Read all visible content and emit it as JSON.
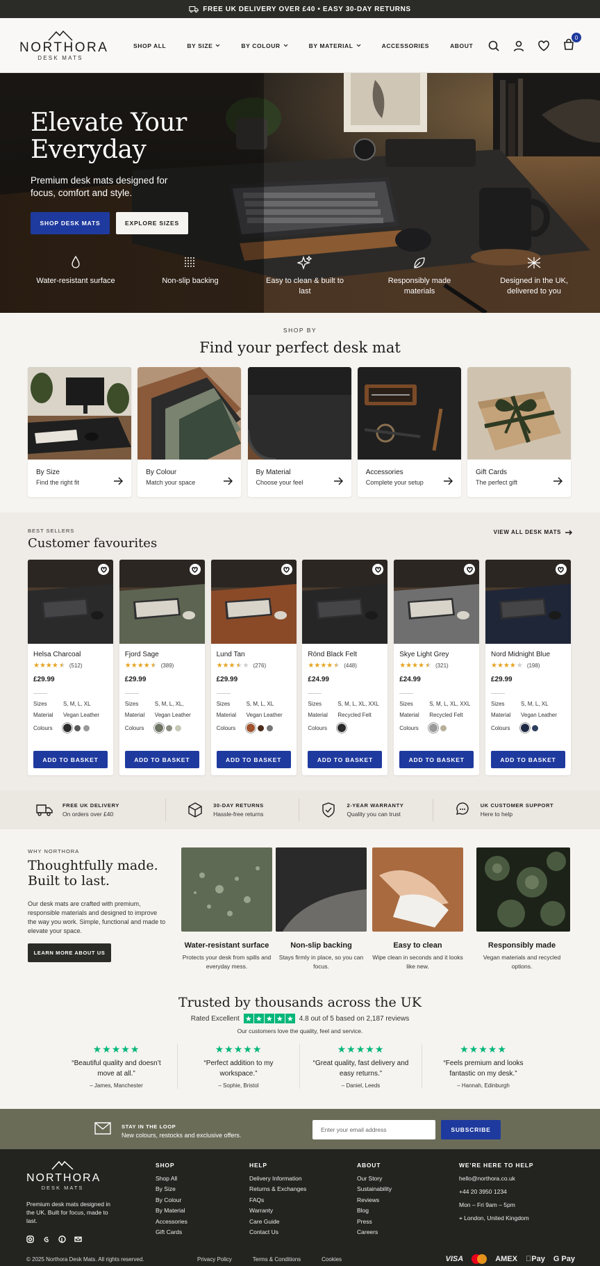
{
  "announcement": {
    "text": "FREE UK DELIVERY OVER £40  •  EASY 30-DAY RETURNS"
  },
  "header": {
    "brand": "NORTHORA",
    "sub": "DESK MATS",
    "nav": [
      "SHOP ALL",
      "BY SIZE",
      "BY COLOUR",
      "BY MATERIAL",
      "ACCESSORIES",
      "ABOUT"
    ],
    "cart_count": "0"
  },
  "hero": {
    "title_line1": "Elevate Your",
    "title_line2": "Everyday",
    "subtitle": "Premium desk mats designed for focus, comfort and style.",
    "btn_primary": "SHOP DESK MATS",
    "btn_secondary": "EXPLORE SIZES",
    "features": [
      {
        "icon": "droplet-icon",
        "label": "Water-resistant surface"
      },
      {
        "icon": "grid-dots-icon",
        "label": "Non-slip backing"
      },
      {
        "icon": "sparkle-icon",
        "label": "Easy to clean & built to last"
      },
      {
        "icon": "leaf-icon",
        "label": "Responsibly made materials"
      },
      {
        "icon": "union-flag-icon",
        "label": "Designed in the UK, delivered to you"
      }
    ]
  },
  "shop_by": {
    "eyebrow": "SHOP BY",
    "title": "Find your perfect desk mat",
    "cards": [
      {
        "title": "By Size",
        "sub": "Find the right fit"
      },
      {
        "title": "By Colour",
        "sub": "Match your space"
      },
      {
        "title": "By Material",
        "sub": "Choose your feel"
      },
      {
        "title": "Accessories",
        "sub": "Complete your setup"
      },
      {
        "title": "Gift Cards",
        "sub": "The perfect gift"
      }
    ]
  },
  "best_sellers": {
    "eyebrow": "BEST SELLERS",
    "title": "Customer favourites",
    "view_all": "VIEW ALL DESK MATS",
    "labels": {
      "sizes": "Sizes",
      "material": "Material",
      "colours": "Colours"
    },
    "add_label": "ADD TO BASKET",
    "products": [
      {
        "name": "Helsa Charcoal",
        "rating": 4.5,
        "reviews": "(512)",
        "price": "£29.99",
        "sizes": "S, M, L, XL",
        "material": "Vegan Leather",
        "colours": [
          "#2b2b2b",
          "#5a5a5a",
          "#9a9a9a"
        ],
        "bg": "#2a2a2a"
      },
      {
        "name": "Fjord Sage",
        "rating": 4.5,
        "reviews": "(389)",
        "price": "£29.99",
        "sizes": "S, M, L, XL,",
        "material": "Vegan Leather",
        "colours": [
          "#6e7463",
          "#8c8e80",
          "#c8c8b8"
        ],
        "bg": "#5d6452"
      },
      {
        "name": "Lund Tan",
        "rating": 3.5,
        "reviews": "(276)",
        "price": "£29.99",
        "sizes": "S, M, L, XL",
        "material": "Vegan Leather",
        "colours": [
          "#a0522d",
          "#4a2a1a",
          "#777"
        ],
        "bg": "#8a4a28"
      },
      {
        "name": "Rönd Black Felt",
        "rating": 4.5,
        "reviews": "(448)",
        "price": "£24.99",
        "sizes": "S, M, L, XL, XXL",
        "material": "Recycled Felt",
        "colours": [
          "#2b2b2b"
        ],
        "bg": "#262626"
      },
      {
        "name": "Skye Light Grey",
        "rating": 4.5,
        "reviews": "(321)",
        "price": "£24.99",
        "sizes": "S, M, L, XL, XXL",
        "material": "Recycled Felt",
        "colours": [
          "#9a9a9a",
          "#b8b09a"
        ],
        "bg": "#6f6f6f"
      },
      {
        "name": "Nord Midnight Blue",
        "rating": 4,
        "reviews": "(198)",
        "price": "£29.99",
        "sizes": "S, M, L, XL",
        "material": "Vegan Leather",
        "colours": [
          "#1e2a44",
          "#2e3e5e"
        ],
        "bg": "#1f2638"
      }
    ]
  },
  "usp": [
    {
      "icon": "truck-icon",
      "title": "FREE UK DELIVERY",
      "desc": "On orders over £40"
    },
    {
      "icon": "box-icon",
      "title": "30-DAY RETURNS",
      "desc": "Hassle-free returns"
    },
    {
      "icon": "shield-icon",
      "title": "2-YEAR WARRANTY",
      "desc": "Quality you can trust"
    },
    {
      "icon": "chat-icon",
      "title": "UK CUSTOMER SUPPORT",
      "desc": "Here to help"
    }
  ],
  "why": {
    "eyebrow": "WHY NORTHORA",
    "title": "Thoughtfully made. Built to last.",
    "text": "Our desk mats are crafted with premium, responsible materials and designed to improve the way you work. Simple, functional and made to elevate your space.",
    "button": "LEARN MORE ABOUT US",
    "cards": [
      {
        "title": "Water-resistant surface",
        "desc": "Protects your desk from spills and everyday mess."
      },
      {
        "title": "Non-slip backing",
        "desc": "Stays firmly in place, so you can focus."
      },
      {
        "title": "Easy to clean",
        "desc": "Wipe clean in seconds and it looks like new."
      },
      {
        "title": "Responsibly made",
        "desc": "Vegan materials and recycled options."
      }
    ]
  },
  "trust": {
    "title": "Trusted by thousands across the UK",
    "rated": "Rated Excellent",
    "score": "4.8 out of 5 based on 2,187 reviews",
    "sub": "Our customers love the quality, feel and service.",
    "reviews": [
      {
        "quote": "“Beautiful quality and doesn’t move at all.”",
        "author": "– James, Manchester"
      },
      {
        "quote": "“Perfect addition to my workspace.”",
        "author": "– Sophie, Bristol"
      },
      {
        "quote": "“Great quality, fast delivery and easy returns.”",
        "author": "– Daniel, Leeds"
      },
      {
        "quote": "“Feels premium and looks fantastic on my desk.”",
        "author": "– Hannah, Edinburgh"
      }
    ]
  },
  "newsletter": {
    "title": "STAY IN THE LOOP",
    "desc": "New colours, restocks and exclusive offers.",
    "placeholder": "Enter your email address",
    "button": "SUBSCRIBE"
  },
  "footer": {
    "brand": "NORTHORA",
    "sub": "DESK MATS",
    "tagline": "Premium desk mats designed in the UK. Built for focus, made to last.",
    "shop": {
      "title": "SHOP",
      "links": [
        "Shop All",
        "By Size",
        "By Colour",
        "By Material",
        "Accessories",
        "Gift Cards"
      ]
    },
    "help": {
      "title": "HELP",
      "links": [
        "Delivery Information",
        "Returns & Exchanges",
        "FAQs",
        "Warranty",
        "Care Guide",
        "Contact Us"
      ]
    },
    "about": {
      "title": "ABOUT",
      "links": [
        "Our Story",
        "Sustainability",
        "Reviews",
        "Blog",
        "Press",
        "Careers"
      ]
    },
    "contact": {
      "title": "WE’RE HERE TO HELP",
      "email": "hello@northora.co.uk",
      "phone": "+44 20 3950 1234",
      "hours": "Mon – Fri 9am – 5pm",
      "location": "London, United Kingdom"
    },
    "copyright": "© 2025 Northora Desk Mats. All rights reserved.",
    "legal": [
      "Privacy Policy",
      "Terms & Conditions",
      "Cookies"
    ],
    "payments": [
      "VISA",
      "AMEX",
      "Pay",
      "G Pay"
    ]
  }
}
